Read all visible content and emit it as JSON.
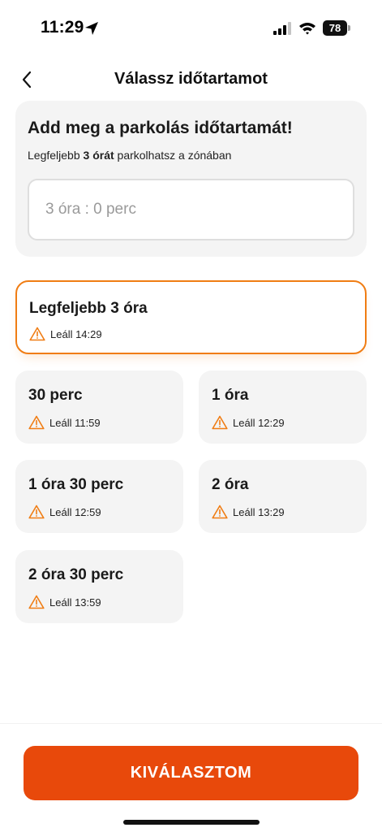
{
  "status_bar": {
    "time": "11:29",
    "battery": "78",
    "icons": [
      "location-arrow-icon",
      "signal-icon",
      "wifi-icon",
      "battery-icon"
    ]
  },
  "header": {
    "title": "Válassz időtartamot",
    "back_icon": "chevron-left-icon"
  },
  "input_card": {
    "title": "Add meg a parkolás időtartamát!",
    "sub_prefix": "Legfeljebb ",
    "sub_bold": "3 órát",
    "sub_suffix": " parkolhatsz a zónában",
    "placeholder": "3 óra : 0 perc"
  },
  "options": [
    {
      "label": "Legfeljebb 3 óra",
      "stop": "Leáll 14:29",
      "selected": true
    },
    {
      "label": "30 perc",
      "stop": "Leáll 11:59",
      "selected": false
    },
    {
      "label": "1 óra",
      "stop": "Leáll 12:29",
      "selected": false
    },
    {
      "label": "1 óra 30 perc",
      "stop": "Leáll 12:59",
      "selected": false
    },
    {
      "label": "2 óra",
      "stop": "Leáll 13:29",
      "selected": false
    },
    {
      "label": "2 óra 30 perc",
      "stop": "Leáll 13:59",
      "selected": false
    }
  ],
  "warning_icon": "warning-triangle-icon",
  "confirm_button": "KIVÁLASZTOM",
  "colors": {
    "accent": "#e8490b",
    "selected_border": "#f07d14",
    "warning": "#f07d14",
    "card_bg": "#f4f4f4"
  }
}
